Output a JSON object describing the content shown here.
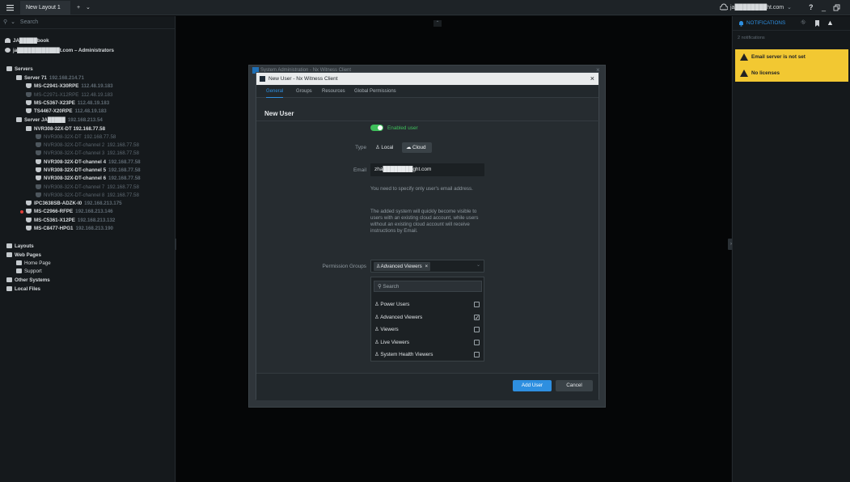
{
  "titlebar": {
    "menu_icon": "hamburger-icon",
    "tab_label": "New Layout 1",
    "tab_close": "×",
    "add_tab": "+",
    "tab_chevron": "⌄",
    "cloud_account": "ja████████ht.com",
    "help": "?",
    "minimize": "_"
  },
  "left": {
    "search_placeholder": "Search",
    "system_name": "JA█████book",
    "user_line": "ja████████████t.com – Administrators",
    "tree": [
      {
        "label": "Servers",
        "ip": "",
        "depth": 0,
        "icon": "servers-icon",
        "bold": true
      },
      {
        "label": "Server 71",
        "ip": "192.168.214.71",
        "depth": 1,
        "icon": "server-icon",
        "bold": true
      },
      {
        "label": "MS-C2941-X30RPE",
        "ip": "112.48.19.183",
        "depth": 2,
        "icon": "camera-icon",
        "bold": true
      },
      {
        "label": "MS-C2971-X12RPE",
        "ip": "112.48.19.183",
        "depth": 2,
        "icon": "camera-icon",
        "dim": true
      },
      {
        "label": "MS-C5367-X23PE",
        "ip": "112.48.19.183",
        "depth": 2,
        "icon": "camera-icon",
        "bold": true
      },
      {
        "label": "TS4467-X20RPE",
        "ip": "112.48.19.183",
        "depth": 2,
        "icon": "camera-icon",
        "bold": true
      },
      {
        "label": "Server JA█████",
        "ip": "192.168.213.54",
        "depth": 1,
        "icon": "server-icon",
        "bold": true
      },
      {
        "label": "NVR308-32X-DT 192.168.77.58",
        "ip": "",
        "depth": 2,
        "icon": "nvr-icon",
        "bold": true
      },
      {
        "label": "NVR308-32X-DT",
        "ip": "192.168.77.58",
        "depth": 3,
        "icon": "camera-icon",
        "dim": true
      },
      {
        "label": "NVR308-32X-DT-channel 2",
        "ip": "192.168.77.58",
        "depth": 3,
        "icon": "camera-icon",
        "dim": true
      },
      {
        "label": "NVR308-32X-DT-channel 3",
        "ip": "192.168.77.58",
        "depth": 3,
        "icon": "camera-icon",
        "dim": true
      },
      {
        "label": "NVR308-32X-DT-channel 4",
        "ip": "192.168.77.58",
        "depth": 3,
        "icon": "camera-icon",
        "bold": true
      },
      {
        "label": "NVR308-32X-DT-channel 5",
        "ip": "192.168.77.58",
        "depth": 3,
        "icon": "camera-icon",
        "bold": true
      },
      {
        "label": "NVR308-32X-DT-channel 6",
        "ip": "192.168.77.58",
        "depth": 3,
        "icon": "camera-icon",
        "bold": true
      },
      {
        "label": "NVR308-32X-DT-channel 7",
        "ip": "192.168.77.58",
        "depth": 3,
        "icon": "camera-icon",
        "dim": true
      },
      {
        "label": "NVR308-32X-DT-channel 8",
        "ip": "192.168.77.58",
        "depth": 3,
        "icon": "camera-icon",
        "dim": true
      },
      {
        "label": "IPC3638SB-ADZK-I0",
        "ip": "192.168.213.175",
        "depth": 2,
        "icon": "camera-icon",
        "bold": true
      },
      {
        "label": "MS-C2966-RFPE",
        "ip": "192.168.213.146",
        "depth": 2,
        "icon": "camera-icon",
        "bold": true,
        "recording": true
      },
      {
        "label": "MS-C5361-X12PE",
        "ip": "192.168.213.132",
        "depth": 2,
        "icon": "camera-icon",
        "bold": true
      },
      {
        "label": "MS-C8477-HPG1",
        "ip": "192.168.213.190",
        "depth": 2,
        "icon": "camera-icon",
        "bold": true
      },
      {
        "label": "Layouts",
        "ip": "",
        "depth": 0,
        "icon": "layouts-icon",
        "bold": true
      },
      {
        "label": "Web Pages",
        "ip": "",
        "depth": 0,
        "icon": "web-pages-icon",
        "bold": true
      },
      {
        "label": "Home Page",
        "ip": "",
        "depth": 1,
        "icon": "web-page-icon"
      },
      {
        "label": "Support",
        "ip": "",
        "depth": 1,
        "icon": "web-page-icon"
      },
      {
        "label": "Other Systems",
        "ip": "",
        "depth": 0,
        "icon": "other-systems-icon",
        "bold": true
      },
      {
        "label": "Local Files",
        "ip": "",
        "depth": 0,
        "icon": "folder-icon",
        "bold": true
      }
    ]
  },
  "right": {
    "notifications_label": "NOTIFICATIONS",
    "notifications_count": "2 notifications",
    "items": [
      "Email server is not set",
      "No licenses"
    ]
  },
  "outer_dialog": {
    "title": "System Administration - Nx Witness Client"
  },
  "dialog": {
    "title": "New User - Nx Witness Client",
    "close": "×",
    "tabs": [
      "General",
      "Groups",
      "Resources",
      "Global Permissions"
    ],
    "heading": "New User",
    "enabled_label": "Enabled user",
    "type_label": "Type",
    "type_local": "Local",
    "type_cloud": "Cloud",
    "email_label": "Email",
    "email_value": "zha████████ght.com",
    "hint1": "You need to specify only user's email address.",
    "hint2": "The added system will quickly become visible to users with an existing cloud account, while users without an existing cloud account will receive instructions by Email.",
    "perm_label": "Permission Groups",
    "perm_chip": "Advanced Viewers",
    "perm_chip_x": "×",
    "dropdown": {
      "search_placeholder": "Search",
      "options": [
        {
          "label": "Power Users",
          "checked": false
        },
        {
          "label": "Advanced Viewers",
          "checked": true
        },
        {
          "label": "Viewers",
          "checked": false
        },
        {
          "label": "Live Viewers",
          "checked": false
        },
        {
          "label": "System Health Viewers",
          "checked": false
        }
      ]
    },
    "add_button": "Add User",
    "cancel_button": "Cancel"
  },
  "colors": {
    "accent": "#2e8fe0",
    "toggle": "#3fbf5b",
    "warning": "#f2c832",
    "recording": "#e0413a"
  }
}
